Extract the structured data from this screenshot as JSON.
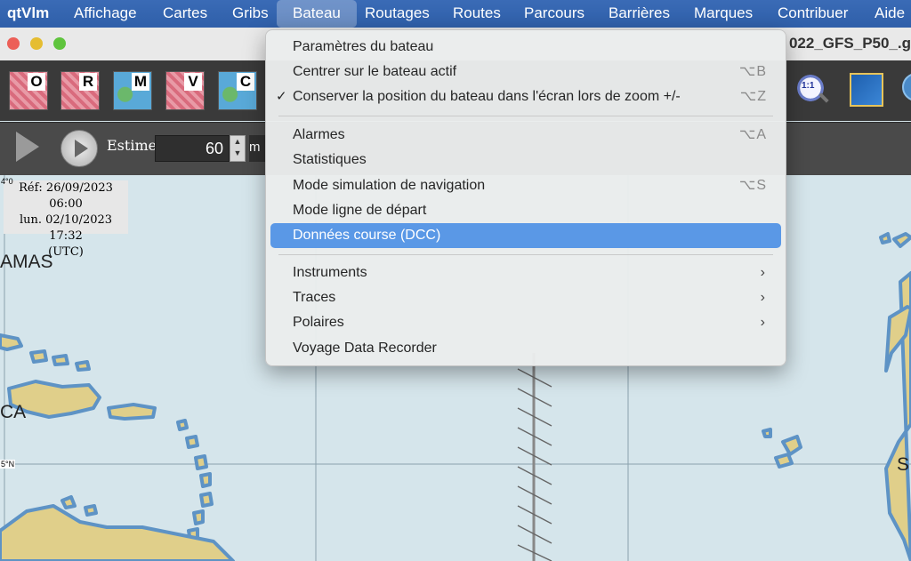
{
  "menubar": {
    "items": [
      "qtVlm",
      "Affichage",
      "Cartes",
      "Gribs",
      "Bateau",
      "Routages",
      "Routes",
      "Parcours",
      "Barrières",
      "Marques",
      "Contribuer",
      "Aide"
    ]
  },
  "window": {
    "title": "022_GFS_P50_.g"
  },
  "toolbar": {
    "map_buttons": [
      "O",
      "R",
      "M",
      "V",
      "C"
    ],
    "estimate_label": "Estime",
    "estimate_value": "60",
    "unit": "m"
  },
  "map": {
    "ref_lines": [
      "Réf: 26/09/2023 06:00",
      "lun. 02/10/2023 17:32",
      "(UTC)"
    ],
    "labels": {
      "bahamas": "AMAS",
      "jamaica": "CA",
      "stlucia": "S"
    },
    "lat_labels": [
      "5°N",
      "4°0"
    ],
    "colors": {
      "sea": "#d5e5eb",
      "land": "#e0cf8a",
      "coast": "#5e93c5"
    }
  },
  "menu": {
    "items": [
      {
        "label": "Paramètres du bateau",
        "shortcut": ""
      },
      {
        "label": "Centrer sur le bateau actif",
        "shortcut": "⌥B"
      },
      {
        "label": "Conserver la position du bateau dans l'écran lors de zoom +/-",
        "shortcut": "⌥Z",
        "checked": "✓"
      },
      {
        "label": "Alarmes",
        "shortcut": "⌥A"
      },
      {
        "label": "Statistiques",
        "shortcut": ""
      },
      {
        "label": "Mode simulation de navigation",
        "shortcut": "⌥S"
      },
      {
        "label": "Mode ligne de départ",
        "shortcut": ""
      },
      {
        "label": "Données course (DCC)",
        "shortcut": "",
        "highlighted": true
      },
      {
        "label": "Instruments",
        "submenu": "›"
      },
      {
        "label": "Traces",
        "submenu": "›"
      },
      {
        "label": "Polaires",
        "submenu": "›"
      },
      {
        "label": "Voyage Data Recorder",
        "shortcut": ""
      }
    ]
  },
  "icons": {
    "zoom": "1:1"
  },
  "accent": "#5a98e6"
}
